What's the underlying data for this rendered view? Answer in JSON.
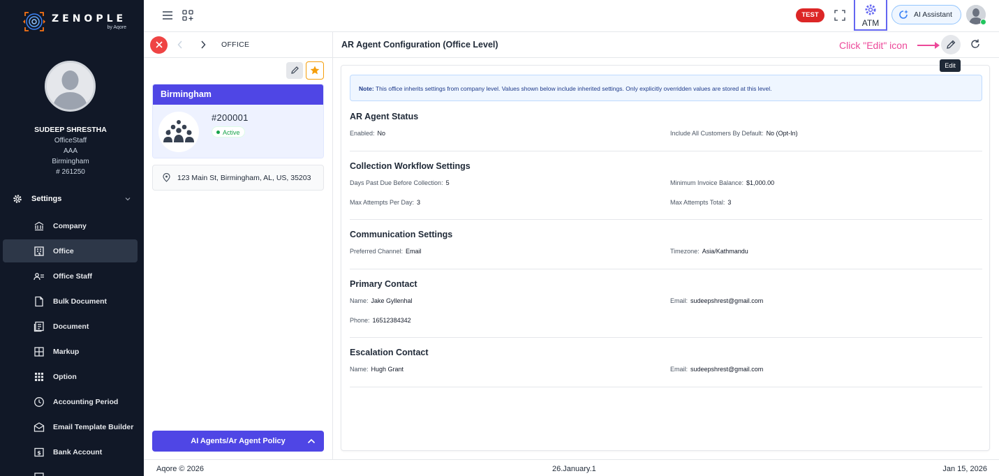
{
  "brand": {
    "name": "ZENOPLE",
    "sub": "by Aqore"
  },
  "user": {
    "name": "SUDEEP SHRESTHA",
    "role": "OfficeStaff",
    "company": "AAA",
    "office": "Birmingham",
    "id": "# 261250"
  },
  "sidebar": {
    "settings_label": "Settings",
    "items": [
      {
        "label": "Company",
        "icon": "bank-icon"
      },
      {
        "label": "Office",
        "icon": "building-icon",
        "active": true
      },
      {
        "label": "Office Staff",
        "icon": "people-icon"
      },
      {
        "label": "Bulk Document",
        "icon": "file-icon"
      },
      {
        "label": "Document",
        "icon": "document-icon"
      },
      {
        "label": "Markup",
        "icon": "grid-icon"
      },
      {
        "label": "Option",
        "icon": "dots-grid-icon"
      },
      {
        "label": "Accounting Period",
        "icon": "clock-icon"
      },
      {
        "label": "Email Template Builder",
        "icon": "envelope-icon"
      },
      {
        "label": "Bank Account",
        "icon": "dollar-card-icon"
      }
    ]
  },
  "topbar": {
    "test_badge": "TEST",
    "atm_label": "ATM",
    "ai_assistant": "AI Assistant"
  },
  "left_panel": {
    "breadcrumb": "OFFICE",
    "office_name": "Birmingham",
    "office_number": "#200001",
    "status": "Active",
    "address": "123 Main St, Birmingham, AL, US, 35203",
    "policy_button": "AI Agents/Ar Agent Policy"
  },
  "main": {
    "title": "AR Agent Configuration (Office Level)",
    "hint": "Click \"Edit\" icon",
    "tooltip": "Edit",
    "note_label": "Note:",
    "note_text": "This office inherits settings from company level. Values shown below include inherited settings. Only explicitly overridden values are stored at this level.",
    "sections": {
      "status": {
        "title": "AR Agent Status",
        "enabled_k": "Enabled:",
        "enabled_v": "No",
        "include_k": "Include All Customers By Default:",
        "include_v": "No (Opt-In)"
      },
      "workflow": {
        "title": "Collection Workflow Settings",
        "days_k": "Days Past Due Before Collection:",
        "days_v": "5",
        "min_k": "Minimum Invoice Balance:",
        "min_v": "$1,000.00",
        "perday_k": "Max Attempts Per Day:",
        "perday_v": "3",
        "total_k": "Max Attempts Total:",
        "total_v": "3"
      },
      "communication": {
        "title": "Communication Settings",
        "channel_k": "Preferred Channel:",
        "channel_v": "Email",
        "tz_k": "Timezone:",
        "tz_v": "Asia/Kathmandu"
      },
      "primary": {
        "title": "Primary Contact",
        "name_k": "Name:",
        "name_v": "Jake Gyllenhal",
        "email_k": "Email:",
        "email_v": "sudeepshrest@gmail.com",
        "phone_k": "Phone:",
        "phone_v": "16512384342"
      },
      "escalation": {
        "title": "Escalation Contact",
        "name_k": "Name:",
        "name_v": "Hugh Grant",
        "email_k": "Email:",
        "email_v": "sudeepshrest@gmail.com"
      }
    }
  },
  "footer": {
    "left": "Aqore © 2026",
    "middle": "26.January.1",
    "right": "Jan 15, 2026"
  },
  "colors": {
    "sidebar": "#111827",
    "accent": "#4f46e5",
    "danger": "#dc2626",
    "hint": "#ec4899",
    "success": "#16a34a"
  }
}
